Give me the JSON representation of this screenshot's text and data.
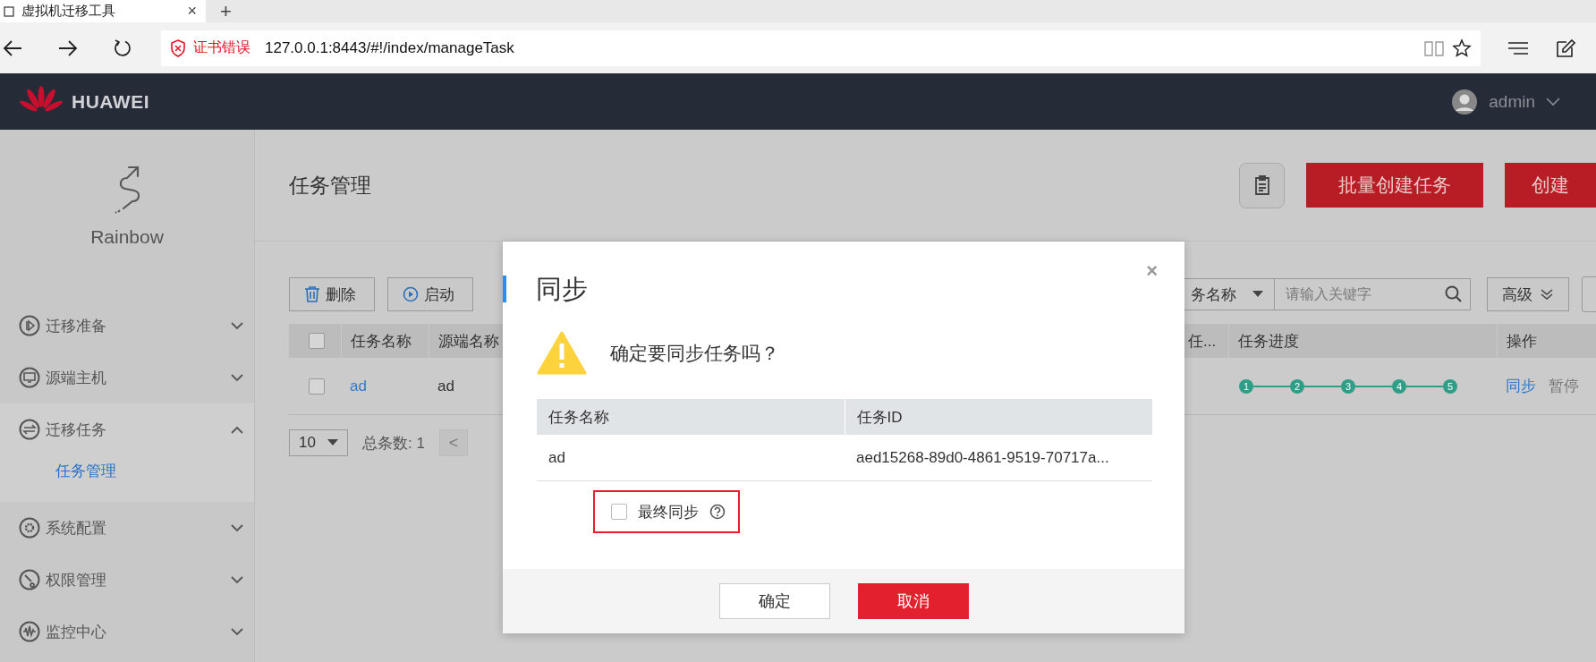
{
  "browser": {
    "tab": {
      "title": "虚拟机迁移工具",
      "close": "×"
    },
    "new_tab": "+",
    "cert_warning": "证书错误",
    "url": "127.0.0.1:8443/#!/index/manageTask"
  },
  "header": {
    "brand": "HUAWEI",
    "user": "admin"
  },
  "sidebar": {
    "app_name": "Rainbow",
    "items": [
      {
        "label": "迁移准备",
        "expanded": false
      },
      {
        "label": "源端主机",
        "expanded": false
      },
      {
        "label": "迁移任务",
        "expanded": true,
        "children": [
          {
            "label": "任务管理",
            "selected": true
          }
        ]
      },
      {
        "label": "系统配置",
        "expanded": false
      },
      {
        "label": "权限管理",
        "expanded": false
      },
      {
        "label": "监控中心",
        "expanded": false
      }
    ]
  },
  "page": {
    "title": "任务管理",
    "actions": [
      "批量创建任务",
      "创建"
    ]
  },
  "toolbar": {
    "buttons": [
      "删除",
      "启动"
    ],
    "search": {
      "field": "务名称",
      "placeholder": "请输入关键字"
    },
    "advanced": "高级"
  },
  "table": {
    "columns": [
      "任务名称",
      "源端名称",
      "任...",
      "任务进度",
      "操作"
    ],
    "all_checked": false,
    "rows": [
      {
        "checked": false,
        "name": "ad",
        "source": "ad",
        "steps": [
          {
            "label": "1",
            "done": true
          },
          {
            "label": "2",
            "done": true
          },
          {
            "label": "3",
            "done": true
          },
          {
            "label": "4",
            "done": true
          },
          {
            "label": "5",
            "done": true
          }
        ],
        "actions": [
          "同步",
          "暂停"
        ]
      }
    ]
  },
  "pagination": {
    "page_size": "10",
    "total": "总条数: 1",
    "prev": "<"
  },
  "dialog": {
    "title": "同步",
    "close": "×",
    "message": "确定要同步任务吗？",
    "columns": [
      "任务名称",
      "任务ID"
    ],
    "rows": [
      [
        "ad",
        "aed15268-89d0-4861-9519-70717a..."
      ]
    ],
    "option": {
      "label": "最终同步",
      "checked": false,
      "highlighted": true
    },
    "buttons": [
      {
        "label": "确定",
        "kind": "secondary"
      },
      {
        "label": "取消",
        "kind": "primary"
      }
    ]
  }
}
